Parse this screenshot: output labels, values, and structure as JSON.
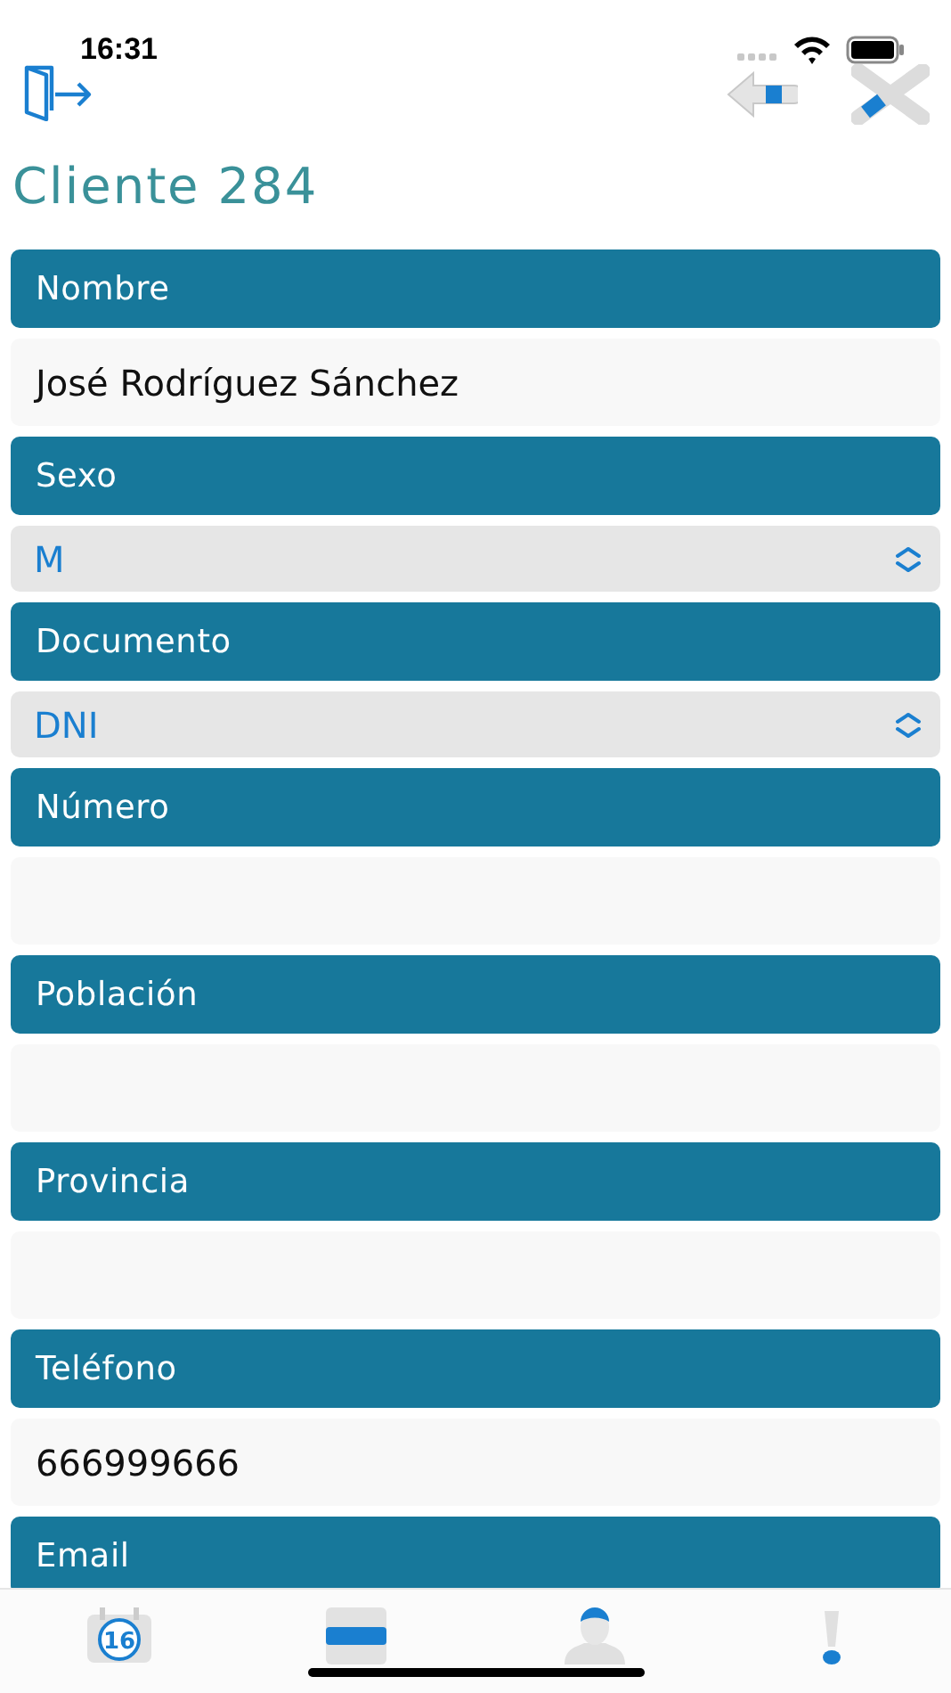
{
  "status_bar": {
    "time": "16:31"
  },
  "title": "Cliente 284",
  "fields": [
    {
      "label": "Nombre",
      "kind": "text",
      "value": "José Rodríguez Sánchez"
    },
    {
      "label": "Sexo",
      "kind": "select",
      "value": "M"
    },
    {
      "label": "Documento",
      "kind": "select",
      "value": "DNI"
    },
    {
      "label": "Número",
      "kind": "text"
    },
    {
      "label": "Población",
      "kind": "text"
    },
    {
      "label": "Provincia",
      "kind": "text"
    },
    {
      "label": "Teléfono",
      "kind": "text",
      "value": "666999666"
    },
    {
      "label": "Email",
      "kind": "label_only"
    }
  ],
  "tab_bar": {
    "calendar_day": "16"
  }
}
